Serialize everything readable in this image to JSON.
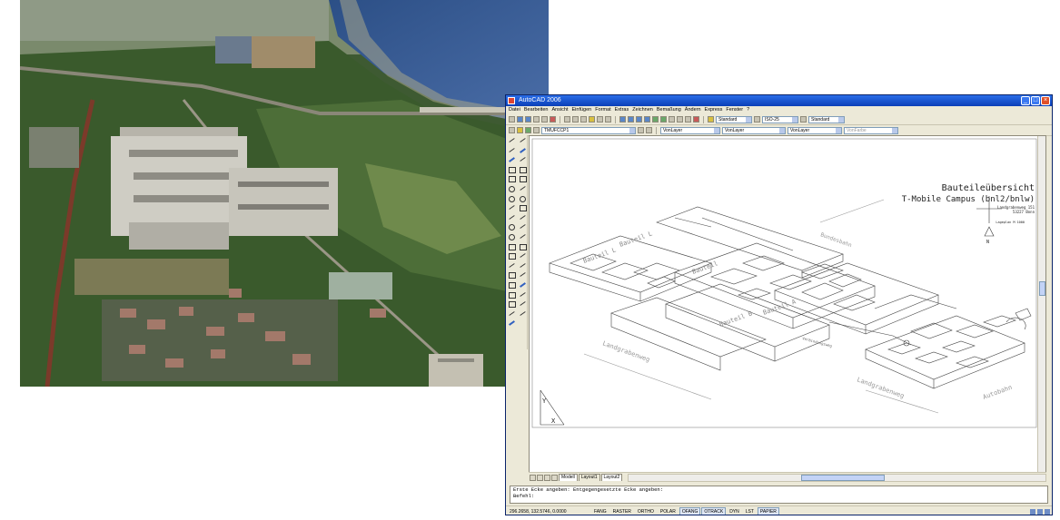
{
  "window": {
    "title": "AutoCAD 2006",
    "controls": {
      "minimize": "_",
      "maximize": "□",
      "close": "×"
    }
  },
  "menu": [
    "Datei",
    "Bearbeiten",
    "Ansicht",
    "Einfügen",
    "Format",
    "Extras",
    "Zeichnen",
    "Bemaßung",
    "Ändern",
    "Express",
    "Fenster",
    "?"
  ],
  "toolbar": {
    "text_style": "Standard",
    "dim_style": "ISO-25",
    "table_style": "Standard",
    "layer": "TMUFCCP1",
    "color": "VonLayer",
    "linetype": "VonLayer",
    "lineweight": "VonLayer",
    "plotstyle": "VonFarbe"
  },
  "drawing": {
    "title_line1": "Bauteileübersicht",
    "title_line2": "T-Mobile Campus (bnl2/bnlw)",
    "address_line1": "Landgrabenweg 151",
    "address_line2": "53227 Bonn",
    "scale_note": "Lageplan M 1000",
    "north_label": "N",
    "labels": {
      "bauteil_l": "Bauteil L",
      "bauteil_l2": "Bauteil L",
      "bauteil_a": "Bauteil A",
      "bauteil_b": "Bauteil B",
      "bauteil_c": "Bauteil",
      "bundesbahn": "Bundesbahn",
      "landgrabenweg1": "Landgrabenweg",
      "landgrabenweg2": "Landgrabenweg",
      "autobahn": "Autobahn",
      "verbindung": "Verbindungsweg"
    },
    "ucs_labels": {
      "y": "Y",
      "x": "X"
    }
  },
  "layout_tabs": [
    "Modell",
    "Layout1",
    "Layout2"
  ],
  "command_lines": [
    "Erste Ecke angeben: Entgegengesetzte Ecke angeben:",
    "Befehl:"
  ],
  "status": {
    "coords": "296.2658, 132.5746, 0.0000",
    "buttons": [
      {
        "label": "FANG",
        "on": false
      },
      {
        "label": "RASTER",
        "on": false
      },
      {
        "label": "ORTHO",
        "on": false
      },
      {
        "label": "POLAR",
        "on": false
      },
      {
        "label": "OFANG",
        "on": true
      },
      {
        "label": "OTRACK",
        "on": true
      },
      {
        "label": "DYN",
        "on": false
      },
      {
        "label": "LST",
        "on": false
      },
      {
        "label": "PAPIER",
        "on": true
      }
    ]
  }
}
